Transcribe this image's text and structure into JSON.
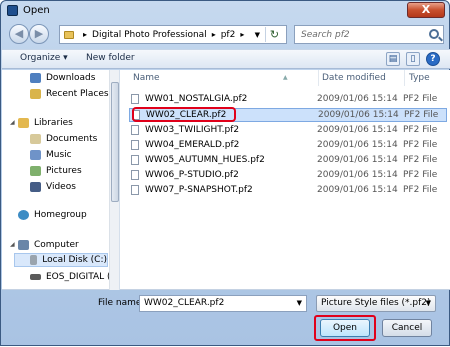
{
  "window": {
    "title": "Open",
    "close_label": "X"
  },
  "address": {
    "crumbs": [
      "Digital Photo Professional",
      "pf2"
    ],
    "search_placeholder": "Search pf2"
  },
  "toolbar": {
    "organize": "Organize ▾",
    "new_folder": "New folder"
  },
  "sidebar": {
    "items": [
      {
        "label": "Downloads"
      },
      {
        "label": "Recent Places"
      },
      {
        "label": "Libraries"
      },
      {
        "label": "Documents"
      },
      {
        "label": "Music"
      },
      {
        "label": "Pictures"
      },
      {
        "label": "Videos"
      },
      {
        "label": "Homegroup"
      },
      {
        "label": "Computer"
      },
      {
        "label": "Local Disk (C:)"
      },
      {
        "label": "EOS_DIGITAL (G:)"
      }
    ]
  },
  "columns": {
    "name": "Name",
    "date": "Date modified",
    "type": "Type"
  },
  "files": [
    {
      "name": "WW01_NOSTALGIA.pf2",
      "date": "2009/01/06 15:14",
      "type": "PF2 File"
    },
    {
      "name": "WW02_CLEAR.pf2",
      "date": "2009/01/06 15:14",
      "type": "PF2 File"
    },
    {
      "name": "WW03_TWILIGHT.pf2",
      "date": "2009/01/06 15:14",
      "type": "PF2 File"
    },
    {
      "name": "WW04_EMERALD.pf2",
      "date": "2009/01/06 15:14",
      "type": "PF2 File"
    },
    {
      "name": "WW05_AUTUMN_HUES.pf2",
      "date": "2009/01/06 15:14",
      "type": "PF2 File"
    },
    {
      "name": "WW06_P-STUDIO.pf2",
      "date": "2009/01/06 15:14",
      "type": "PF2 File"
    },
    {
      "name": "WW07_P-SNAPSHOT.pf2",
      "date": "2009/01/06 15:14",
      "type": "PF2 File"
    }
  ],
  "footer": {
    "file_name_label": "File name:",
    "file_name_value": "WW02_CLEAR.pf2",
    "filter_value": "Picture Style files (*.pf2)",
    "open_label": "Open",
    "cancel_label": "Cancel"
  }
}
